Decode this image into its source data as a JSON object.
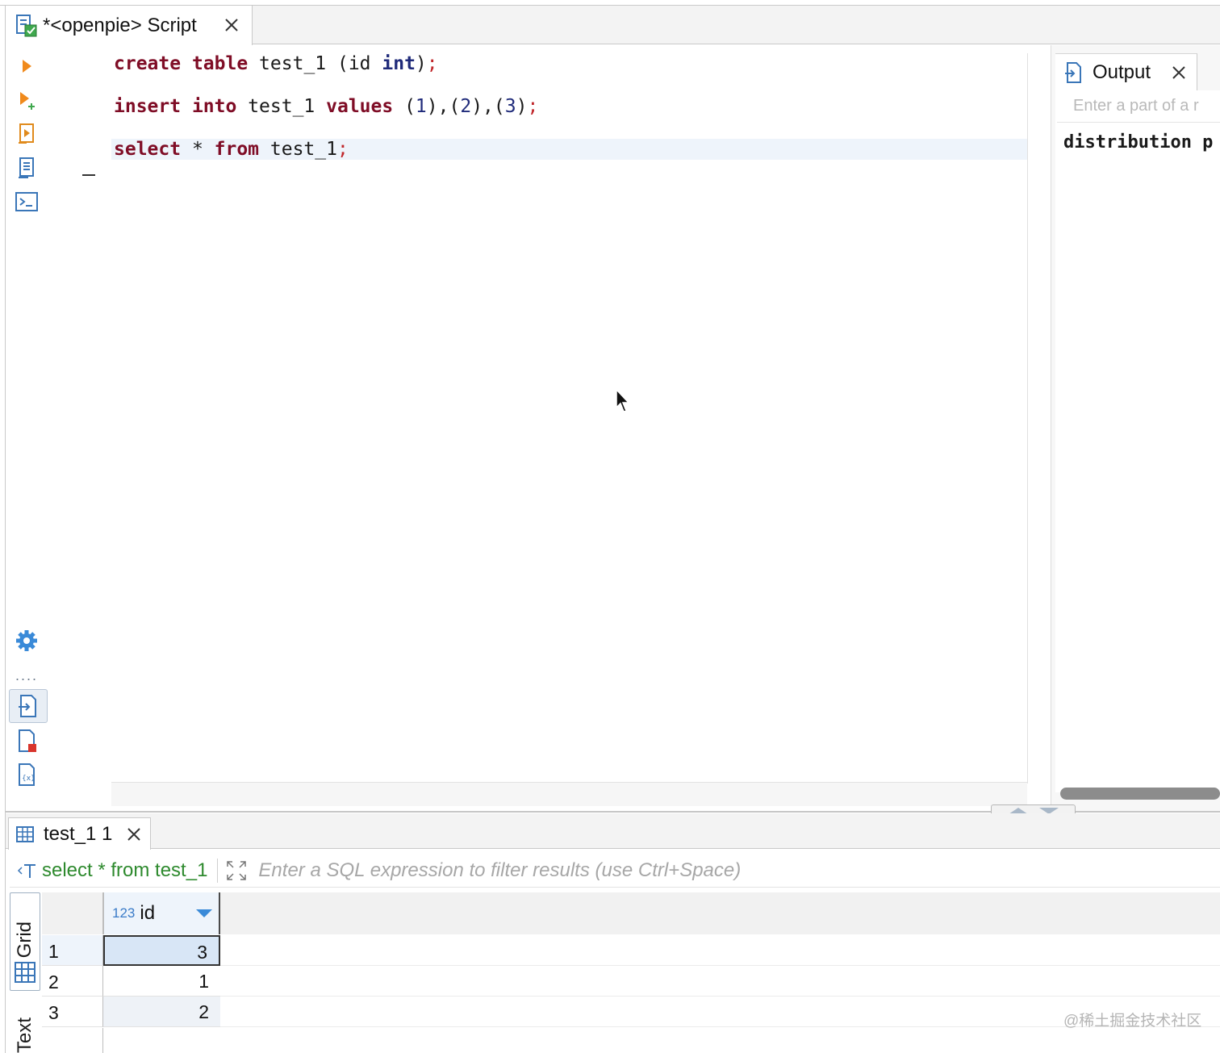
{
  "editor_tab": {
    "title": "*<openpie> Script"
  },
  "left_toolbar": {
    "top": [
      "execute-statement-icon",
      "execute-script-icon",
      "explain-plan-icon",
      "load-script-icon",
      "open-console-icon"
    ],
    "bottom": [
      "settings-icon",
      "output-panel-icon",
      "error-log-icon",
      "variables-icon"
    ],
    "more": "...."
  },
  "editor": {
    "lines": [
      [
        {
          "t": "create",
          "c": "kw"
        },
        {
          "t": " ",
          "c": "punc"
        },
        {
          "t": "table",
          "c": "kw"
        },
        {
          "t": " test_1 (id ",
          "c": "ident"
        },
        {
          "t": "int",
          "c": "kw2"
        },
        {
          "t": ")",
          "c": "punc"
        },
        {
          "t": ";",
          "c": "semi"
        }
      ],
      [
        {
          "t": "insert",
          "c": "kw"
        },
        {
          "t": " ",
          "c": "punc"
        },
        {
          "t": "into",
          "c": "kw"
        },
        {
          "t": " test_1 ",
          "c": "ident"
        },
        {
          "t": "values",
          "c": "kw"
        },
        {
          "t": " (",
          "c": "punc"
        },
        {
          "t": "1",
          "c": "num"
        },
        {
          "t": "),(",
          "c": "punc"
        },
        {
          "t": "2",
          "c": "num"
        },
        {
          "t": "),(",
          "c": "punc"
        },
        {
          "t": "3",
          "c": "num"
        },
        {
          "t": ")",
          "c": "punc"
        },
        {
          "t": ";",
          "c": "semi"
        }
      ],
      [
        {
          "t": "select",
          "c": "kw"
        },
        {
          "t": " * ",
          "c": "punc"
        },
        {
          "t": "from",
          "c": "kw"
        },
        {
          "t": " test_1",
          "c": "ident"
        },
        {
          "t": ";",
          "c": "semi"
        }
      ]
    ]
  },
  "output_panel": {
    "tab_label": "Output",
    "filter_placeholder": "Enter a part of a r",
    "text": "distribution p"
  },
  "results": {
    "tab_label": "test_1 1",
    "query": "select * from test_1",
    "filter_placeholder": "Enter a SQL expression to filter results (use Ctrl+Space)",
    "view_tabs": {
      "grid": "Grid",
      "text": "Text"
    },
    "column": {
      "type_badge": "123",
      "name": "id"
    },
    "rows": [
      {
        "num": "1",
        "id": "3"
      },
      {
        "num": "2",
        "id": "1"
      },
      {
        "num": "3",
        "id": "2"
      }
    ],
    "selected_row": 0
  },
  "watermark": "@稀土掘金技术社区",
  "colors": {
    "keyword": "#7f0d26",
    "type_keyword": "#1f2a7a",
    "query_text": "#2e8a2e",
    "selection": "#d8e6f6"
  }
}
